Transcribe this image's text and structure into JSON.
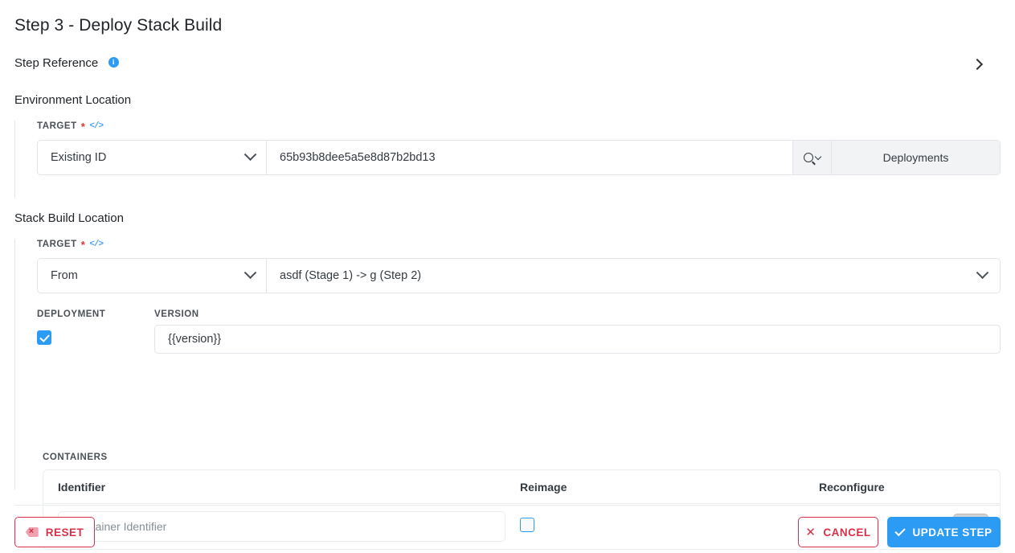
{
  "header": {
    "title": "Step 3 - Deploy Stack Build",
    "step_reference_label": "Step Reference",
    "info_icon": "info-icon",
    "expand_icon": "chevron-right-icon"
  },
  "environment_location": {
    "heading": "Environment Location",
    "target": {
      "label": "TARGET",
      "required_marker": "*",
      "code_icon": "</>",
      "mode_value": "Existing ID",
      "mode_caret": "chevron-down-icon",
      "id_value": "65b93b8dee5a5e8d87b2bd13",
      "search_icon": "search-icon",
      "search_caret": "chevron-down-icon",
      "action_label": "Deployments"
    }
  },
  "stack_build_location": {
    "heading": "Stack Build Location",
    "target": {
      "label": "TARGET",
      "required_marker": "*",
      "code_icon": "</>",
      "mode_value": "From",
      "mode_caret": "chevron-down-icon",
      "source_value": "asdf (Stage 1) -> g (Step 2)",
      "source_caret": "chevron-down-icon"
    },
    "deployment": {
      "label": "DEPLOYMENT",
      "checked": true
    },
    "version": {
      "label": "VERSION",
      "value": "{{version}}"
    },
    "containers": {
      "label": "CONTAINERS",
      "columns": [
        "Identifier",
        "Reimage",
        "Reconfigure"
      ],
      "rows": [
        {
          "identifier_placeholder": "Container Identifier",
          "identifier_value": "",
          "reimage_checked": false,
          "reconfigure_checked": false
        }
      ],
      "add_button_label": "+"
    }
  },
  "footer": {
    "reset_label": "Reset",
    "reset_icon": "tag-x-icon",
    "cancel_label": "Cancel",
    "cancel_icon": "close-icon",
    "update_label": "Update Step",
    "update_icon": "check-icon"
  },
  "colors": {
    "accent_blue": "#2b9bf4",
    "danger_red": "#d9304a",
    "required_star": "#e03131",
    "panel_rule": "#e3e5e8",
    "input_border": "#e1e4e8",
    "muted_fill": "#f1f3f5"
  }
}
